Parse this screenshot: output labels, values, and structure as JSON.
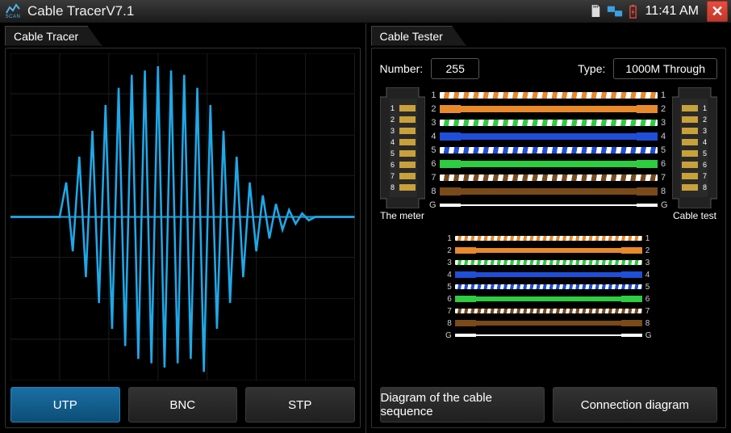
{
  "statusbar": {
    "app_title": "Cable TracerV7.1",
    "scan_label": "SCAN",
    "time": "11:41 AM"
  },
  "tracer": {
    "title": "Cable Tracer",
    "buttons": {
      "utp": "UTP",
      "bnc": "BNC",
      "stp": "STP"
    },
    "active": "utp"
  },
  "tester": {
    "title": "Cable Tester",
    "number_label": "Number:",
    "number_value": "255",
    "type_label": "Type:",
    "type_value": "1000M Through",
    "meter_label": "The meter",
    "test_label": "Cable test",
    "buttons": {
      "diagram_seq": "Diagram of the cable sequence",
      "conn_diagram": "Connection diagram"
    },
    "wires": [
      {
        "n": "1",
        "color": "#e8892b",
        "style": "striped"
      },
      {
        "n": "2",
        "color": "#e8892b",
        "style": "solid"
      },
      {
        "n": "3",
        "color": "#2ecc40",
        "style": "striped"
      },
      {
        "n": "4",
        "color": "#1f4fd8",
        "style": "solid"
      },
      {
        "n": "5",
        "color": "#1f4fd8",
        "style": "striped"
      },
      {
        "n": "6",
        "color": "#2ecc40",
        "style": "solid"
      },
      {
        "n": "7",
        "color": "#7a4a1a",
        "style": "striped"
      },
      {
        "n": "8",
        "color": "#7a4a1a",
        "style": "solid"
      },
      {
        "n": "G",
        "color": "#ffffff",
        "style": "solid"
      }
    ]
  }
}
